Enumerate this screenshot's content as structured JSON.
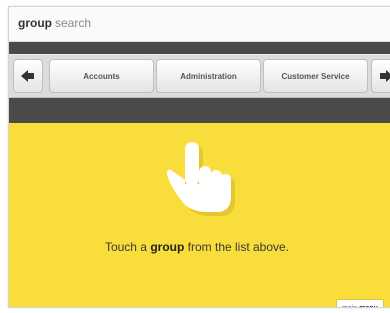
{
  "header": {
    "title_bold": "group",
    "title_light": "search"
  },
  "nav": {
    "prev_icon": "arrow-left-icon",
    "next_icon": "arrow-right-icon",
    "tabs": [
      {
        "label": "Accounts"
      },
      {
        "label": "Administration"
      },
      {
        "label": "Customer Service"
      }
    ]
  },
  "main": {
    "icon": "pointing-hand-icon",
    "prompt_pre": "Touch a ",
    "prompt_bold": "group",
    "prompt_post": " from the list above."
  },
  "footer": {
    "menu_light": "main",
    "menu_bold": "menu"
  },
  "colors": {
    "accent_yellow": "#f8dd3b",
    "nav_dark": "#4a4a4a"
  }
}
